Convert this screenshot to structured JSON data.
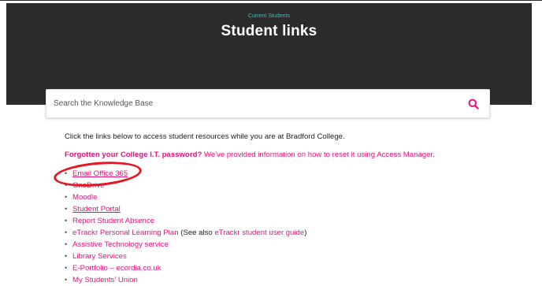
{
  "hero": {
    "eyebrow": "Current Students",
    "title": "Student links"
  },
  "search": {
    "placeholder": "Search the Knowledge Base",
    "value": ""
  },
  "content": {
    "intro": "Click the links below to access student resources while you are at Bradford College.",
    "password_link": "Forgotten your College I.T. password?",
    "password_rest": " We've provided information on how to reset it using Access Manager.",
    "links": [
      {
        "label": "Email Office 365",
        "prefix": "",
        "suffix": "",
        "extra": ""
      },
      {
        "label": "OneDrive",
        "prefix": "",
        "suffix": "",
        "extra": ""
      },
      {
        "label": "Moodle",
        "prefix": "",
        "suffix": "",
        "extra": ""
      },
      {
        "label": "Student Portal",
        "prefix": "",
        "suffix": "",
        "extra": ""
      },
      {
        "label": "Report Student Absence",
        "prefix": "",
        "suffix": "",
        "extra": ""
      },
      {
        "label": "eTrackr Personal Learning Plan",
        "suffix": " (See also ",
        "extra": "eTrackr student user guide",
        "close": ")"
      },
      {
        "label": "Assistive Technology service"
      },
      {
        "label": "Library Services"
      },
      {
        "label": "E-Portfolio – ecordia.co.uk"
      },
      {
        "label": "My Students' Union"
      }
    ]
  },
  "colors": {
    "hero_bg": "#2b2b2c",
    "accent_teal": "#1ec8c8",
    "link_pink": "#e0147a",
    "annotation_red": "#e8141f"
  },
  "icons": {
    "search": "search-icon"
  }
}
